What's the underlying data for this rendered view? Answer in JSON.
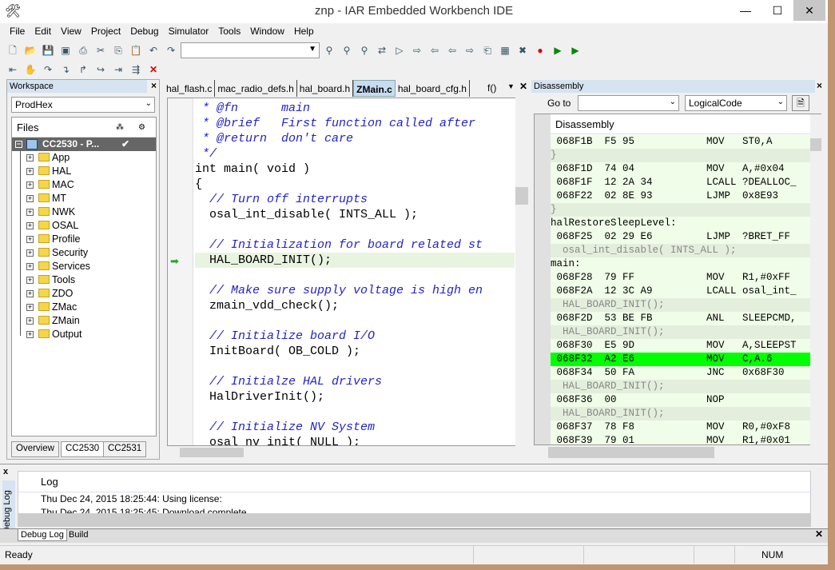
{
  "window": {
    "title": "znp - IAR Embedded Workbench IDE",
    "minimize": "—",
    "maximize": "☐",
    "close": "✕"
  },
  "menu": [
    "File",
    "Edit",
    "View",
    "Project",
    "Debug",
    "Simulator",
    "Tools",
    "Window",
    "Help"
  ],
  "workspace": {
    "title": "Workspace",
    "config": "ProdHex",
    "files_header": "Files",
    "project": "CC2530 - P...",
    "project_check": "✔",
    "items": [
      "App",
      "HAL",
      "MAC",
      "MT",
      "NWK",
      "OSAL",
      "Profile",
      "Security",
      "Services",
      "Tools",
      "ZDO",
      "ZMac",
      "ZMain",
      "Output"
    ],
    "tabs": [
      "Overview",
      "CC2530",
      "CC2531"
    ]
  },
  "editor": {
    "tabs": [
      "hal_flash.c",
      "mac_radio_defs.h",
      "hal_board.h",
      "ZMain.c",
      "hal_board_cfg.h"
    ],
    "active_tab": "ZMain.c",
    "func_label": "f()",
    "lines": [
      {
        "t": " * @fn      main",
        "c": "cm"
      },
      {
        "t": " * @brief   First function called after",
        "c": "cm"
      },
      {
        "t": " * @return  don't care",
        "c": "cm"
      },
      {
        "t": " */",
        "c": "cm"
      },
      {
        "t": "int main( void )",
        "c": ""
      },
      {
        "t": "{",
        "c": ""
      },
      {
        "t": "  // Turn off interrupts",
        "c": "cm"
      },
      {
        "t": "  osal_int_disable( INTS_ALL );",
        "c": ""
      },
      {
        "t": "",
        "c": ""
      },
      {
        "t": "  // Initialization for board related st",
        "c": "cm"
      },
      {
        "t": "  HAL_BOARD_INIT();",
        "c": "hl"
      },
      {
        "t": "",
        "c": ""
      },
      {
        "t": "  // Make sure supply voltage is high en",
        "c": "cm"
      },
      {
        "t": "  zmain_vdd_check();",
        "c": ""
      },
      {
        "t": "",
        "c": ""
      },
      {
        "t": "  // Initialize board I/O",
        "c": "cm"
      },
      {
        "t": "  InitBoard( OB_COLD );",
        "c": ""
      },
      {
        "t": "",
        "c": ""
      },
      {
        "t": "  // Initialze HAL drivers",
        "c": "cm"
      },
      {
        "t": "  HalDriverInit();",
        "c": ""
      },
      {
        "t": "",
        "c": ""
      },
      {
        "t": "  // Initialize NV System",
        "c": "cm"
      },
      {
        "t": "  osal nv init( NULL );",
        "c": ""
      }
    ]
  },
  "disassembly": {
    "title": "Disassembly",
    "goto_label": "Go to",
    "goto_value": "",
    "mode": "LogicalCode",
    "header": "Disassembly",
    "rows": [
      {
        "t": " 068F1B  F5 95            MOV   ST0,A",
        "k": "code"
      },
      {
        "t": "}",
        "k": "src"
      },
      {
        "t": " 068F1D  74 04            MOV   A,#0x04",
        "k": "code"
      },
      {
        "t": " 068F1F  12 2A 34         LCALL ?DEALLOC_",
        "k": "code"
      },
      {
        "t": " 068F22  02 8E 93         LJMP  0x8E93",
        "k": "code"
      },
      {
        "t": "}",
        "k": "src"
      },
      {
        "t": "halRestoreSleepLevel:",
        "k": "label"
      },
      {
        "t": " 068F25  02 29 E6         LJMP  ?BRET_FF",
        "k": "code"
      },
      {
        "t": "  osal_int_disable( INTS_ALL );",
        "k": "src"
      },
      {
        "t": "main:",
        "k": "label"
      },
      {
        "t": " 068F28  79 FF            MOV   R1,#0xFF",
        "k": "code"
      },
      {
        "t": " 068F2A  12 3C A9         LCALL osal_int_",
        "k": "code"
      },
      {
        "t": "  HAL_BOARD_INIT();",
        "k": "src"
      },
      {
        "t": " 068F2D  53 BE FB         ANL   SLEEPCMD,",
        "k": "code"
      },
      {
        "t": "  HAL_BOARD_INIT();",
        "k": "src"
      },
      {
        "t": " 068F30  E5 9D            MOV   A,SLEEPST",
        "k": "code"
      },
      {
        "t": " 068F32  A2 E6            MOV   C,A.6",
        "k": "cur"
      },
      {
        "t": " 068F34  50 FA            JNC   0x68F30",
        "k": "code"
      },
      {
        "t": "  HAL_BOARD_INIT();",
        "k": "src"
      },
      {
        "t": " 068F36  00               NOP",
        "k": "code"
      },
      {
        "t": "  HAL_BOARD_INIT();",
        "k": "src"
      },
      {
        "t": " 068F37  78 F8            MOV   R0,#0xF8",
        "k": "code"
      },
      {
        "t": " 068F39  79 01            MOV   R1,#0x01",
        "k": "code"
      }
    ]
  },
  "log": {
    "side_label": "Debug Log",
    "header": "Log",
    "lines": [
      "Thu Dec 24, 2015 18:25:44: Using license:",
      "Thu Dec 24, 2015 18:25:45: Download complete."
    ],
    "tabs": [
      "Debug Log",
      "Build"
    ]
  },
  "status": {
    "text": "Ready",
    "num": "NUM"
  },
  "colors": {
    "current_line": "#00ff00",
    "comment": "#2222cc",
    "panel_header": "#d6e3f0"
  }
}
